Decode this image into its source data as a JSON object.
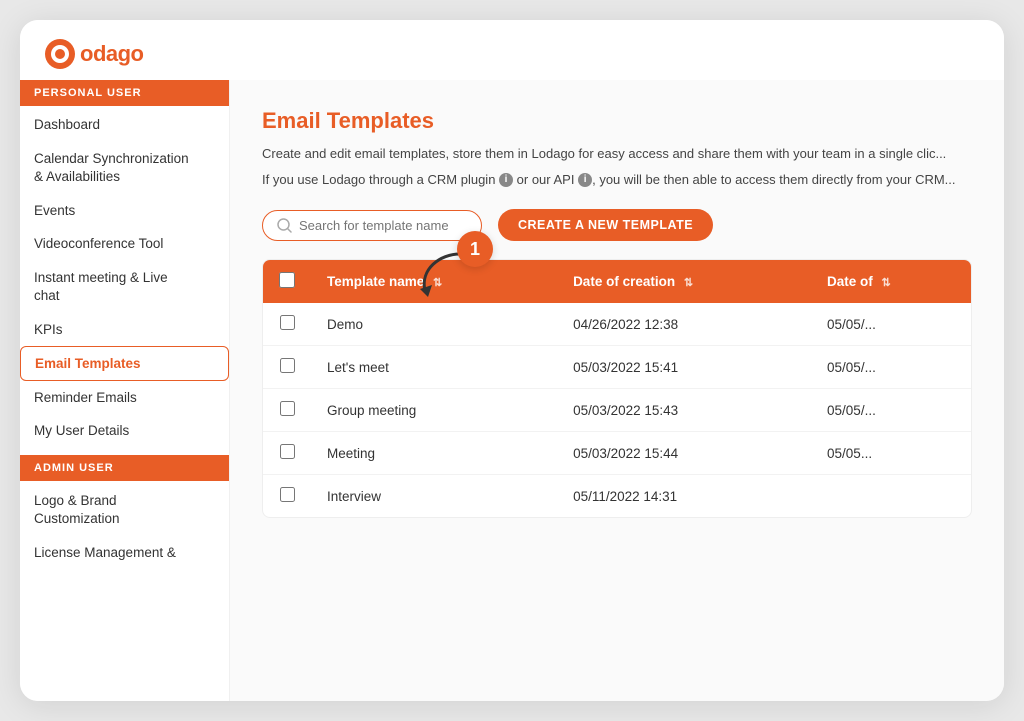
{
  "logo": {
    "text": "odago",
    "icon_label": "lodago-logo-icon"
  },
  "sidebar": {
    "personal_section_label": "PERSONAL USER",
    "admin_section_label": "ADMIN USER",
    "personal_items": [
      {
        "id": "dashboard",
        "label": "Dashboard",
        "active": false
      },
      {
        "id": "calendar-sync",
        "label": "Calendar Synchronization & Availabilities",
        "active": false,
        "multiline": true
      },
      {
        "id": "events",
        "label": "Events",
        "active": false
      },
      {
        "id": "videoconference",
        "label": "Videoconference Tool",
        "active": false
      },
      {
        "id": "instant-meeting",
        "label": "Instant meeting & Live chat",
        "active": false,
        "multiline": true
      },
      {
        "id": "kpis",
        "label": "KPIs",
        "active": false
      },
      {
        "id": "email-templates",
        "label": "Email Templates",
        "active": true
      },
      {
        "id": "reminder-emails",
        "label": "Reminder Emails",
        "active": false
      },
      {
        "id": "my-user-details",
        "label": "My User Details",
        "active": false
      }
    ],
    "admin_items": [
      {
        "id": "logo-brand",
        "label": "Logo & Brand Customization",
        "active": false,
        "multiline": true
      },
      {
        "id": "license-management",
        "label": "License Management &",
        "active": false
      }
    ]
  },
  "main": {
    "page_title": "Email Templates",
    "description1": "Create and edit email templates, store them in Lodago for easy access and share them with your team in a single clic...",
    "description2": "If you use Lodago through a CRM plugin  or our API , you will be then able to access them directly from your CRM...",
    "search_placeholder": "Search for template name",
    "create_button_label": "CREATE A NEW TEMPLATE",
    "step_badge": "1",
    "table": {
      "columns": [
        {
          "id": "checkbox",
          "label": "",
          "sortable": false
        },
        {
          "id": "template-name",
          "label": "Template name",
          "sortable": true
        },
        {
          "id": "date-of-creation",
          "label": "Date of creation",
          "sortable": true
        },
        {
          "id": "date-of",
          "label": "Date of",
          "sortable": true
        }
      ],
      "rows": [
        {
          "id": 1,
          "name": "Demo",
          "date_creation": "04/26/2022 12:38",
          "date_of": "05/05/..."
        },
        {
          "id": 2,
          "name": "Let's meet",
          "date_creation": "05/03/2022 15:41",
          "date_of": "05/05/..."
        },
        {
          "id": 3,
          "name": "Group meeting",
          "date_creation": "05/03/2022 15:43",
          "date_of": "05/05/..."
        },
        {
          "id": 4,
          "name": "Meeting",
          "date_creation": "05/03/2022 15:44",
          "date_of": "05/05..."
        },
        {
          "id": 5,
          "name": "Interview",
          "date_creation": "05/11/2022 14:31",
          "date_of": ""
        }
      ]
    }
  },
  "colors": {
    "brand_orange": "#e85d26",
    "white": "#ffffff",
    "text_dark": "#333333",
    "text_gray": "#999999"
  }
}
